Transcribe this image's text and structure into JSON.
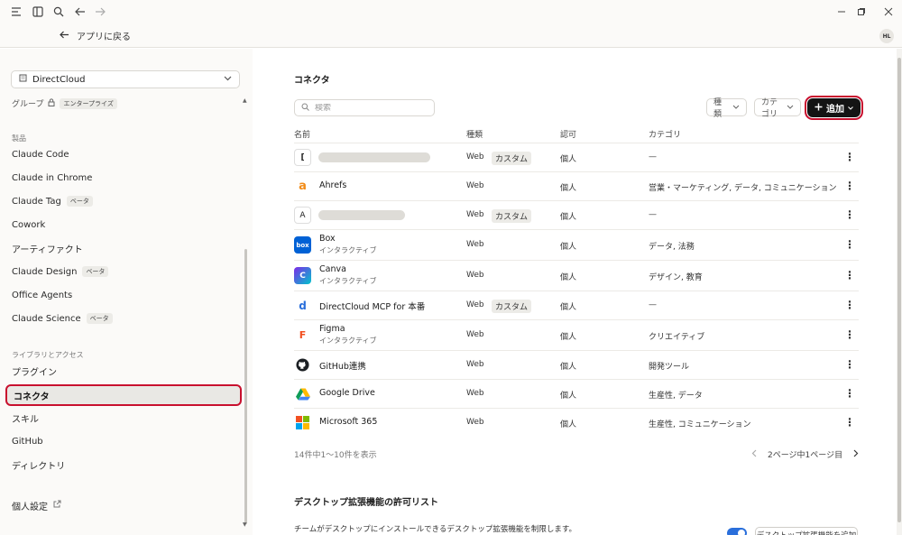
{
  "window": {
    "back_label": "アプリに戻る",
    "avatar": "HL"
  },
  "sidebar": {
    "org_name": "DirectCloud",
    "group_label": "グループ",
    "group_badge": "エンタープライズ",
    "sections": {
      "products": "製品",
      "library": "ライブラリとアクセス"
    },
    "product_items": [
      {
        "label": "Claude Code",
        "badge": ""
      },
      {
        "label": "Claude in Chrome",
        "badge": ""
      },
      {
        "label": "Claude Tag",
        "badge": "ベータ"
      },
      {
        "label": "Cowork",
        "badge": ""
      },
      {
        "label": "アーティファクト",
        "badge": ""
      },
      {
        "label": "Claude Design",
        "badge": "ベータ"
      },
      {
        "label": "Office Agents",
        "badge": ""
      },
      {
        "label": "Claude Science",
        "badge": "ベータ"
      }
    ],
    "library_items": [
      {
        "label": "プラグイン"
      },
      {
        "label": "コネクタ"
      },
      {
        "label": "スキル"
      },
      {
        "label": "GitHub"
      },
      {
        "label": "ディレクトリ"
      }
    ],
    "personal_settings": "個人設定"
  },
  "main": {
    "title": "コネクタ",
    "search_placeholder": "検索",
    "filter_type": "種類",
    "filter_category": "カテゴリ",
    "add_label": "追加",
    "columns": {
      "name": "名前",
      "type": "種類",
      "auth": "認可",
      "category": "カテゴリ"
    },
    "rows": [
      {
        "icon": "[",
        "name": "",
        "sub": "",
        "type": "Web",
        "badge": "カスタム",
        "auth": "個人",
        "category": "—",
        "redacted": true
      },
      {
        "icon": "a",
        "name": "Ahrefs",
        "sub": "",
        "type": "Web",
        "badge": "",
        "auth": "個人",
        "category": "営業・マーケティング, データ, コミュニケーション"
      },
      {
        "icon": "A",
        "name": "",
        "sub": "",
        "type": "Web",
        "badge": "カスタム",
        "auth": "個人",
        "category": "—",
        "redacted": true
      },
      {
        "icon": "box",
        "name": "Box",
        "sub": "インタラクティブ",
        "type": "Web",
        "badge": "",
        "auth": "個人",
        "category": "データ, 法務"
      },
      {
        "icon": "C",
        "name": "Canva",
        "sub": "インタラクティブ",
        "type": "Web",
        "badge": "",
        "auth": "個人",
        "category": "デザイン, 教育"
      },
      {
        "icon": "d",
        "name": "DirectCloud MCP for 本番",
        "sub": "",
        "type": "Web",
        "badge": "カスタム",
        "auth": "個人",
        "category": "—"
      },
      {
        "icon": "F",
        "name": "Figma",
        "sub": "インタラクティブ",
        "type": "Web",
        "badge": "",
        "auth": "個人",
        "category": "クリエイティブ"
      },
      {
        "icon": "gh",
        "name": "GitHub連携",
        "sub": "",
        "type": "Web",
        "badge": "",
        "auth": "個人",
        "category": "開発ツール"
      },
      {
        "icon": "gd",
        "name": "Google Drive",
        "sub": "",
        "type": "Web",
        "badge": "",
        "auth": "個人",
        "category": "生産性, データ"
      },
      {
        "icon": "ms",
        "name": "Microsoft 365",
        "sub": "",
        "type": "Web",
        "badge": "",
        "auth": "個人",
        "category": "生産性, コミュニケーション"
      }
    ],
    "count_text": "14件中1〜10件を表示",
    "pager_text": "2ページ中1ページ目",
    "allowlist_title": "デスクトップ拡張機能の許可リスト",
    "allowlist_desc": "チームがデスクトップにインストールできるデスクトップ拡張機能を制限します。",
    "allowlist_button": "デスクトップ拡張機能を追加"
  },
  "colors": {
    "highlight": "#c8102e",
    "toggle_on": "#2a6fdb"
  }
}
